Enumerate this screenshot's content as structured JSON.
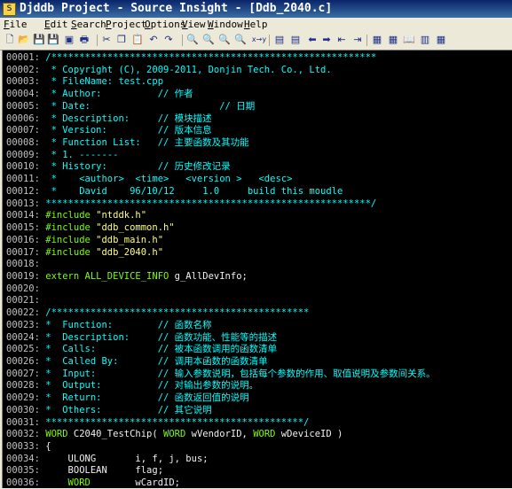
{
  "window": {
    "title": "Djddb Project - Source Insight - [Ddb_2040.c]"
  },
  "menu": [
    {
      "label": "File",
      "accel": "F",
      "rest": "ile"
    },
    {
      "label": "Edit",
      "accel": "E",
      "rest": "dit"
    },
    {
      "label": "Search",
      "accel": "S",
      "rest": "earch"
    },
    {
      "label": "Project",
      "accel": "P",
      "rest": "roject"
    },
    {
      "label": "Options",
      "accel": "O",
      "rest": "ptions"
    },
    {
      "label": "View",
      "accel": "V",
      "rest": "iew"
    },
    {
      "label": "Window",
      "accel": "W",
      "rest": "indow"
    },
    {
      "label": "Help",
      "accel": "H",
      "rest": "elp"
    }
  ],
  "toolbar": [
    {
      "name": "new-file-icon",
      "glyph": "🗋"
    },
    {
      "name": "open-folder-icon",
      "glyph": "📂"
    },
    {
      "name": "save-icon",
      "glyph": "💾"
    },
    {
      "name": "save-all-icon",
      "glyph": "💾"
    },
    {
      "name": "close-file-icon",
      "glyph": "▣"
    },
    {
      "name": "print-icon",
      "glyph": "🖶"
    },
    {
      "name": "cut-icon",
      "glyph": "✂"
    },
    {
      "name": "copy-icon",
      "glyph": "❐"
    },
    {
      "name": "paste-icon",
      "glyph": "📋"
    },
    {
      "name": "undo-icon",
      "glyph": "↶"
    },
    {
      "name": "redo-icon",
      "glyph": "↷"
    },
    {
      "name": "search-icon",
      "glyph": "🔍"
    },
    {
      "name": "search-backward-icon",
      "glyph": "🔍"
    },
    {
      "name": "search-forward-icon",
      "glyph": "🔍"
    },
    {
      "name": "search-files-icon",
      "glyph": "🔍"
    },
    {
      "name": "replace-icon",
      "glyph": "x→y"
    },
    {
      "name": "bookmark-icon",
      "glyph": "▤"
    },
    {
      "name": "bookmark-toggle-icon",
      "glyph": "▤"
    },
    {
      "name": "back-icon",
      "glyph": "⬅"
    },
    {
      "name": "forward-icon",
      "glyph": "➡"
    },
    {
      "name": "jump-back-icon",
      "glyph": "⇤"
    },
    {
      "name": "jump-forward-icon",
      "glyph": "⇥"
    },
    {
      "name": "symbol-window-icon",
      "glyph": "▦"
    },
    {
      "name": "relation-window-icon",
      "glyph": "▦"
    },
    {
      "name": "book-icon",
      "glyph": "📖"
    },
    {
      "name": "browse-icon",
      "glyph": "▥"
    },
    {
      "name": "info-icon",
      "glyph": "▦"
    }
  ],
  "code": [
    {
      "n": "00001:",
      "parts": [
        {
          "t": " /**********************************************************",
          "c": "comment"
        }
      ]
    },
    {
      "n": "00002:",
      "parts": [
        {
          "t": "  * Copyright (C), 2009-2011, Donjin Tech. Co., Ltd.",
          "c": "comment"
        }
      ]
    },
    {
      "n": "00003:",
      "parts": [
        {
          "t": "  * FileName: test.cpp",
          "c": "comment"
        }
      ]
    },
    {
      "n": "00004:",
      "parts": [
        {
          "t": "  * Author:          // 作者",
          "c": "comment"
        }
      ]
    },
    {
      "n": "00005:",
      "parts": [
        {
          "t": "  * Date:                       // 日期",
          "c": "comment"
        }
      ]
    },
    {
      "n": "00006:",
      "parts": [
        {
          "t": "  * Description:     // 模块描述",
          "c": "comment"
        }
      ]
    },
    {
      "n": "00007:",
      "parts": [
        {
          "t": "  * Version:         // 版本信息",
          "c": "comment"
        }
      ]
    },
    {
      "n": "00008:",
      "parts": [
        {
          "t": "  * Function List:   // 主要函数及其功能",
          "c": "comment"
        }
      ]
    },
    {
      "n": "00009:",
      "parts": [
        {
          "t": "  * 1. -------",
          "c": "comment"
        }
      ]
    },
    {
      "n": "00010:",
      "parts": [
        {
          "t": "  * History:         // 历史修改记录",
          "c": "comment"
        }
      ]
    },
    {
      "n": "00011:",
      "parts": [
        {
          "t": "  *    <author>  <time>   <version >   <desc>",
          "c": "comment"
        }
      ]
    },
    {
      "n": "00012:",
      "parts": [
        {
          "t": "  *    David    96/10/12     1.0     build this moudle",
          "c": "comment"
        }
      ]
    },
    {
      "n": "00013:",
      "parts": [
        {
          "t": " **********************************************************/",
          "c": "comment"
        }
      ]
    },
    {
      "n": "00014:",
      "parts": [
        {
          "t": " #include ",
          "c": "inc"
        },
        {
          "t": "\"ntddk.h\"",
          "c": "str"
        }
      ]
    },
    {
      "n": "00015:",
      "parts": [
        {
          "t": " #include ",
          "c": "inc"
        },
        {
          "t": "\"ddb_common.h\"",
          "c": "str"
        }
      ]
    },
    {
      "n": "00016:",
      "parts": [
        {
          "t": " #include ",
          "c": "inc"
        },
        {
          "t": "\"ddb_main.h\"",
          "c": "str"
        }
      ]
    },
    {
      "n": "00017:",
      "parts": [
        {
          "t": " #include ",
          "c": "inc"
        },
        {
          "t": "\"ddb_2040.h\"",
          "c": "str"
        }
      ]
    },
    {
      "n": "00018:",
      "parts": []
    },
    {
      "n": "00019:",
      "parts": [
        {
          "t": " extern ALL_DEVICE_INFO ",
          "c": "kw"
        },
        {
          "t": "g_AllDevInfo;",
          "c": "plain"
        }
      ]
    },
    {
      "n": "00020:",
      "parts": []
    },
    {
      "n": "00021:",
      "parts": []
    },
    {
      "n": "00022:",
      "parts": [
        {
          "t": " /**********************************************",
          "c": "comment"
        }
      ]
    },
    {
      "n": "00023:",
      "parts": [
        {
          "t": " *  Function:        // 函数名称",
          "c": "comment"
        }
      ]
    },
    {
      "n": "00024:",
      "parts": [
        {
          "t": " *  Description:     // 函数功能、性能等的描述",
          "c": "comment"
        }
      ]
    },
    {
      "n": "00025:",
      "parts": [
        {
          "t": " *  Calls:           // 被本函数调用的函数清单",
          "c": "comment"
        }
      ]
    },
    {
      "n": "00026:",
      "parts": [
        {
          "t": " *  Called By:       // 调用本函数的函数清单",
          "c": "comment"
        }
      ]
    },
    {
      "n": "00027:",
      "parts": [
        {
          "t": " *  Input:           // 输入参数说明，包括每个参数的作用、取值说明及参数间关系。",
          "c": "comment"
        }
      ]
    },
    {
      "n": "00028:",
      "parts": [
        {
          "t": " *  Output:          // 对输出参数的说明。",
          "c": "comment"
        }
      ]
    },
    {
      "n": "00029:",
      "parts": [
        {
          "t": " *  Return:          // 函数返回值的说明",
          "c": "comment"
        }
      ]
    },
    {
      "n": "00030:",
      "parts": [
        {
          "t": " *  Others:          // 其它说明",
          "c": "comment"
        }
      ]
    },
    {
      "n": "00031:",
      "parts": [
        {
          "t": " **********************************************/",
          "c": "comment"
        }
      ]
    },
    {
      "n": "00032:",
      "parts": [
        {
          "t": " WORD ",
          "c": "kw"
        },
        {
          "t": "C2040_TestChip( ",
          "c": "plain"
        },
        {
          "t": "WORD ",
          "c": "kw"
        },
        {
          "t": "wVendorID, ",
          "c": "plain"
        },
        {
          "t": "WORD ",
          "c": "kw"
        },
        {
          "t": "wDeviceID )",
          "c": "plain"
        }
      ]
    },
    {
      "n": "00033:",
      "parts": [
        {
          "t": " {",
          "c": "plain"
        }
      ]
    },
    {
      "n": "00034:",
      "parts": [
        {
          "t": "     ULONG       i, f, j, bus;",
          "c": "plain"
        }
      ]
    },
    {
      "n": "00035:",
      "parts": [
        {
          "t": "     BOOLEAN     flag;",
          "c": "plain"
        }
      ]
    },
    {
      "n": "00036:",
      "parts": [
        {
          "t": "     WORD        ",
          "c": "kw"
        },
        {
          "t": "wCardID;",
          "c": "plain"
        }
      ]
    }
  ]
}
